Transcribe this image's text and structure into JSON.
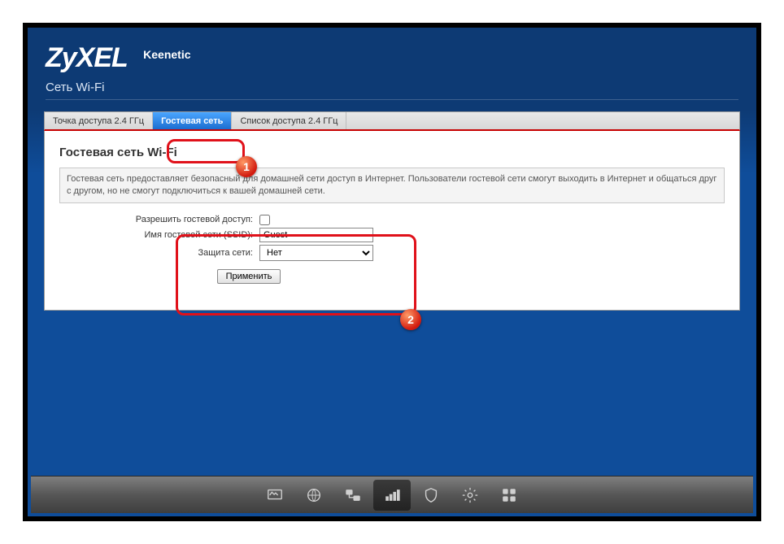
{
  "header": {
    "brand": "ZyXEL",
    "model": "Keenetic",
    "section_title": "Сеть Wi-Fi"
  },
  "tabs": [
    "Точка доступа 2.4 ГГц",
    "Гостевая сеть",
    "Список доступа 2.4 ГГц"
  ],
  "panel": {
    "title": "Гостевая сеть Wi-Fi",
    "info": "Гостевая сеть предоставляет безопасный для домашней сети доступ в Интернет. Пользователи гостевой сети смогут выходить в Интернет и общаться друг с другом, но не смогут подключиться к вашей домашней сети."
  },
  "form": {
    "allow_label": "Разрешить гостевой доступ:",
    "ssid_label": "Имя гостевой сети (SSID):",
    "ssid_value": "Guest",
    "security_label": "Защита сети:",
    "security_value": "Нет",
    "apply": "Применить"
  },
  "badges": {
    "one": "1",
    "two": "2"
  }
}
